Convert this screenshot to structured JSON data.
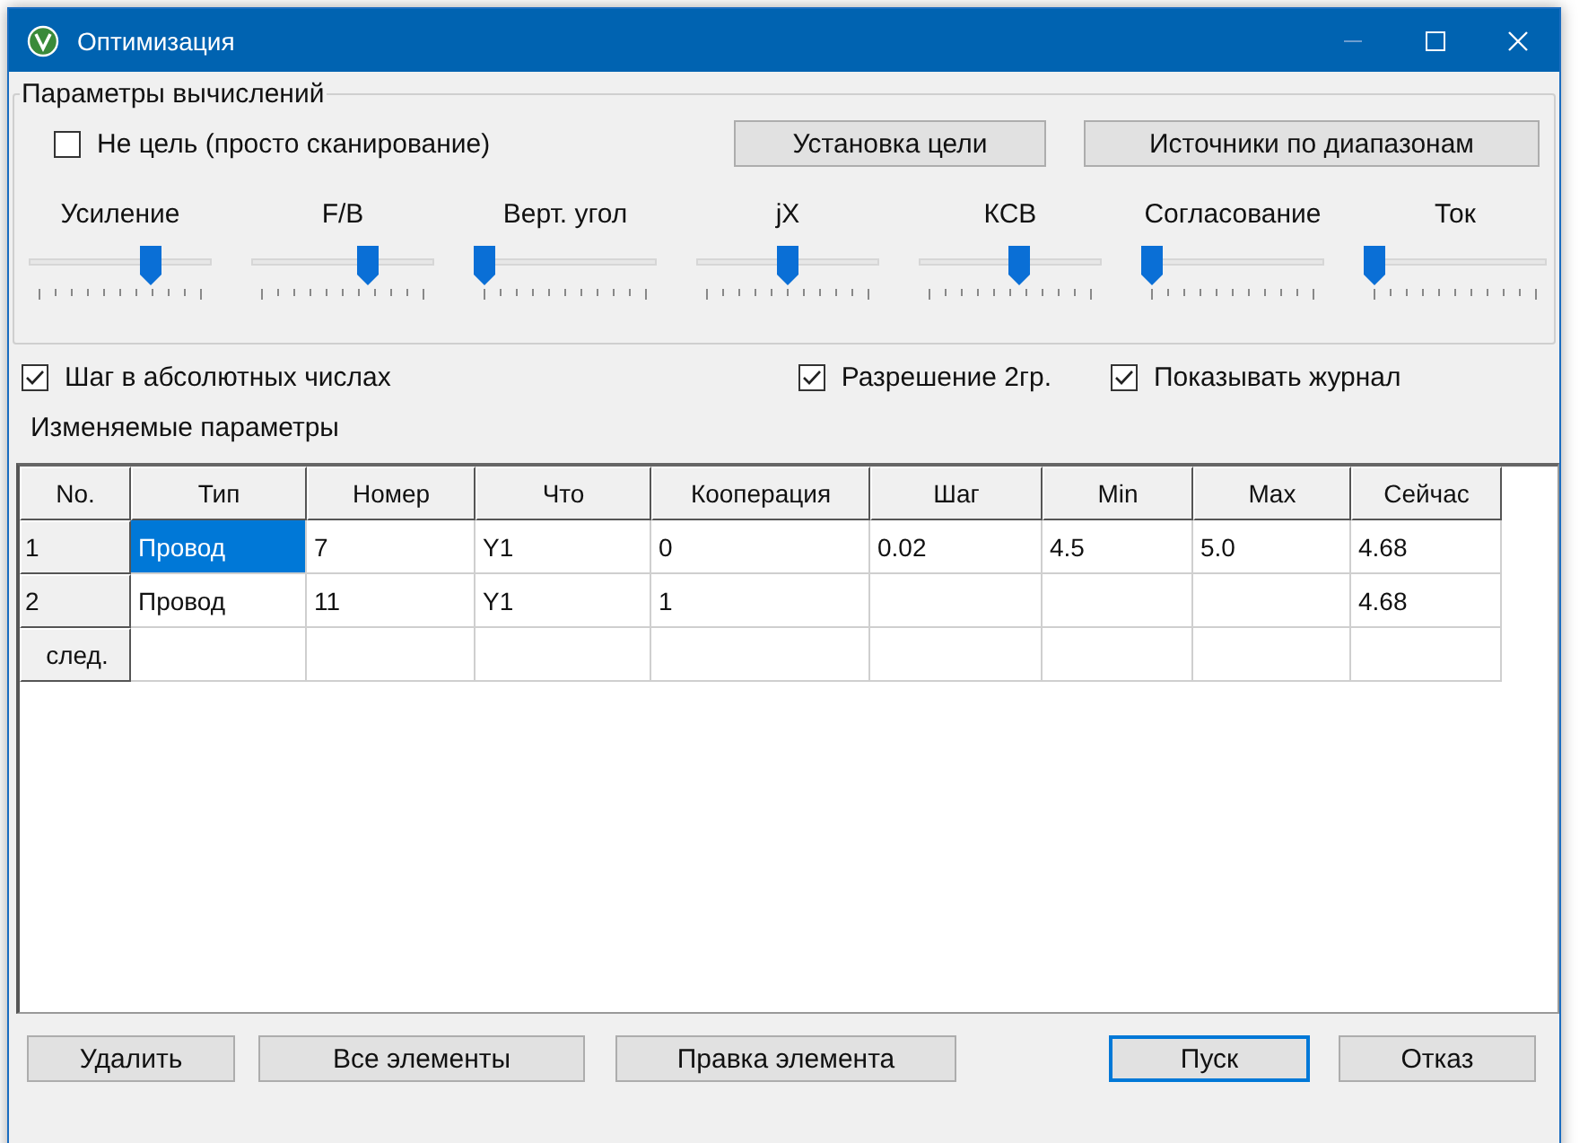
{
  "window": {
    "title": "Оптимизация"
  },
  "group": {
    "title": "Параметры вычислений"
  },
  "no_target": {
    "label": "Не цель (просто сканирование)",
    "checked": false
  },
  "top_buttons": [
    "Установка цели",
    "Источники по диапазонам"
  ],
  "sliders": [
    {
      "label": "Усиление",
      "level": 0.69
    },
    {
      "label": "F/B",
      "level": 0.66
    },
    {
      "label": "Верт. угол",
      "level": 0
    },
    {
      "label": "jX",
      "level": 0.5
    },
    {
      "label": "КСВ",
      "level": 0.55
    },
    {
      "label": "Согласование",
      "level": 0
    },
    {
      "label": "Ток",
      "level": 0
    }
  ],
  "options": [
    {
      "label": "Шаг в абсолютных числах",
      "checked": true
    },
    {
      "label": "Разрешение 2гр.",
      "checked": true
    },
    {
      "label": "Показывать журнал",
      "checked": true
    }
  ],
  "table_label": "Изменяемые параметры",
  "table": {
    "columns": [
      "No.",
      "Тип",
      "Номер",
      "Что",
      "Кооперация",
      "Шаг",
      "Min",
      "Max",
      "Сейчас"
    ],
    "rows": [
      {
        "cells": [
          {
            "text": "1",
            "selected": false
          },
          {
            "text": "Провод",
            "selected": true
          },
          {
            "text": "7",
            "selected": false
          },
          {
            "text": "Y1",
            "selected": false
          },
          {
            "text": "0",
            "selected": false
          },
          {
            "text": "0.02",
            "selected": false
          },
          {
            "text": "4.5",
            "selected": false
          },
          {
            "text": "5.0",
            "selected": false
          },
          {
            "text": "4.68",
            "selected": false
          }
        ]
      },
      {
        "cells": [
          {
            "text": "2",
            "selected": false
          },
          {
            "text": "Провод",
            "selected": false
          },
          {
            "text": "11",
            "selected": false
          },
          {
            "text": "Y1",
            "selected": false
          },
          {
            "text": "1",
            "selected": false
          },
          {
            "selected": false
          },
          {
            "selected": false
          },
          {
            "selected": false
          },
          {
            "text": "4.68",
            "selected": false
          }
        ]
      },
      {
        "cells": [
          {
            "text": "след.",
            "selected": false
          },
          {
            "selected": false
          },
          {
            "selected": false
          },
          {
            "selected": false
          },
          {
            "selected": false
          },
          {
            "selected": false
          },
          {
            "selected": false
          },
          {
            "selected": false
          },
          {
            "selected": false
          }
        ]
      }
    ]
  },
  "bottom_buttons": [
    {
      "label": "Удалить",
      "default": false
    },
    {
      "label": "Все элементы",
      "default": false
    },
    {
      "label": "Правка элемента",
      "default": false
    },
    {
      "label": "Пуск",
      "default": true
    },
    {
      "label": "Отказ",
      "default": false
    }
  ]
}
